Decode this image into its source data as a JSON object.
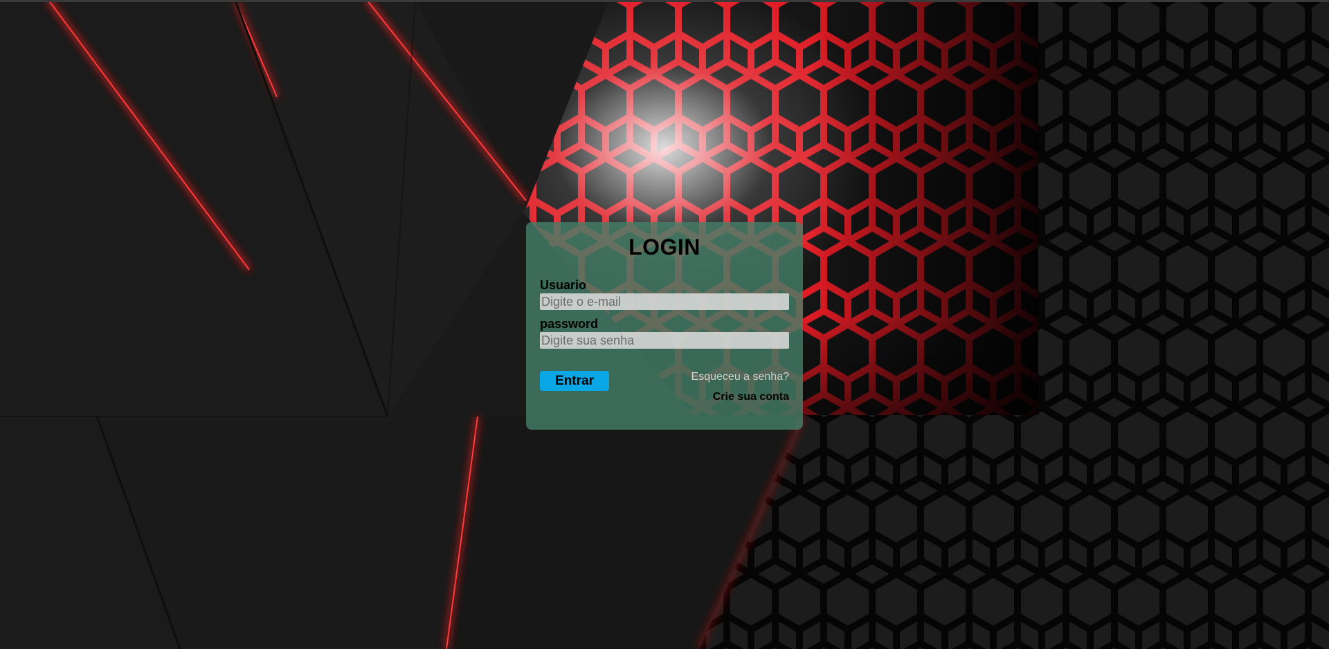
{
  "login": {
    "title": "LOGIN",
    "user_label": "Usuario",
    "user_placeholder": "Digite o e-mail",
    "user_value": "",
    "password_label": "password",
    "password_placeholder": "Digite sua senha",
    "password_value": "",
    "submit_label": "Entrar",
    "forgot_label": "Esqueceu a senha?",
    "create_label": "Crie sua conta"
  },
  "colors": {
    "background": "#1a1a1a",
    "accent_red": "#e01b24",
    "card": "#46806a",
    "button": "#0aa7e6"
  }
}
